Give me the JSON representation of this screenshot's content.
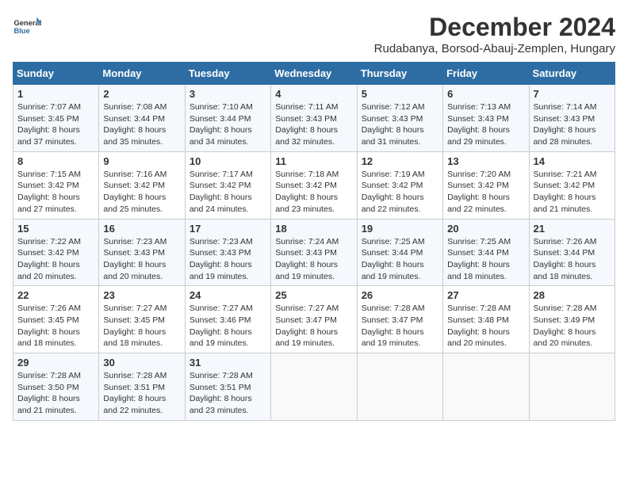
{
  "header": {
    "logo_line1": "General",
    "logo_line2": "Blue",
    "title": "December 2024",
    "subtitle": "Rudabanya, Borsod-Abauj-Zemplen, Hungary"
  },
  "days_of_week": [
    "Sunday",
    "Monday",
    "Tuesday",
    "Wednesday",
    "Thursday",
    "Friday",
    "Saturday"
  ],
  "weeks": [
    [
      {
        "day": 1,
        "sunrise": "7:07 AM",
        "sunset": "3:45 PM",
        "daylight": "8 hours and 37 minutes."
      },
      {
        "day": 2,
        "sunrise": "7:08 AM",
        "sunset": "3:44 PM",
        "daylight": "8 hours and 35 minutes."
      },
      {
        "day": 3,
        "sunrise": "7:10 AM",
        "sunset": "3:44 PM",
        "daylight": "8 hours and 34 minutes."
      },
      {
        "day": 4,
        "sunrise": "7:11 AM",
        "sunset": "3:43 PM",
        "daylight": "8 hours and 32 minutes."
      },
      {
        "day": 5,
        "sunrise": "7:12 AM",
        "sunset": "3:43 PM",
        "daylight": "8 hours and 31 minutes."
      },
      {
        "day": 6,
        "sunrise": "7:13 AM",
        "sunset": "3:43 PM",
        "daylight": "8 hours and 29 minutes."
      },
      {
        "day": 7,
        "sunrise": "7:14 AM",
        "sunset": "3:43 PM",
        "daylight": "8 hours and 28 minutes."
      }
    ],
    [
      {
        "day": 8,
        "sunrise": "7:15 AM",
        "sunset": "3:42 PM",
        "daylight": "8 hours and 27 minutes."
      },
      {
        "day": 9,
        "sunrise": "7:16 AM",
        "sunset": "3:42 PM",
        "daylight": "8 hours and 25 minutes."
      },
      {
        "day": 10,
        "sunrise": "7:17 AM",
        "sunset": "3:42 PM",
        "daylight": "8 hours and 24 minutes."
      },
      {
        "day": 11,
        "sunrise": "7:18 AM",
        "sunset": "3:42 PM",
        "daylight": "8 hours and 23 minutes."
      },
      {
        "day": 12,
        "sunrise": "7:19 AM",
        "sunset": "3:42 PM",
        "daylight": "8 hours and 22 minutes."
      },
      {
        "day": 13,
        "sunrise": "7:20 AM",
        "sunset": "3:42 PM",
        "daylight": "8 hours and 22 minutes."
      },
      {
        "day": 14,
        "sunrise": "7:21 AM",
        "sunset": "3:42 PM",
        "daylight": "8 hours and 21 minutes."
      }
    ],
    [
      {
        "day": 15,
        "sunrise": "7:22 AM",
        "sunset": "3:42 PM",
        "daylight": "8 hours and 20 minutes."
      },
      {
        "day": 16,
        "sunrise": "7:23 AM",
        "sunset": "3:43 PM",
        "daylight": "8 hours and 20 minutes."
      },
      {
        "day": 17,
        "sunrise": "7:23 AM",
        "sunset": "3:43 PM",
        "daylight": "8 hours and 19 minutes."
      },
      {
        "day": 18,
        "sunrise": "7:24 AM",
        "sunset": "3:43 PM",
        "daylight": "8 hours and 19 minutes."
      },
      {
        "day": 19,
        "sunrise": "7:25 AM",
        "sunset": "3:44 PM",
        "daylight": "8 hours and 19 minutes."
      },
      {
        "day": 20,
        "sunrise": "7:25 AM",
        "sunset": "3:44 PM",
        "daylight": "8 hours and 18 minutes."
      },
      {
        "day": 21,
        "sunrise": "7:26 AM",
        "sunset": "3:44 PM",
        "daylight": "8 hours and 18 minutes."
      }
    ],
    [
      {
        "day": 22,
        "sunrise": "7:26 AM",
        "sunset": "3:45 PM",
        "daylight": "8 hours and 18 minutes."
      },
      {
        "day": 23,
        "sunrise": "7:27 AM",
        "sunset": "3:45 PM",
        "daylight": "8 hours and 18 minutes."
      },
      {
        "day": 24,
        "sunrise": "7:27 AM",
        "sunset": "3:46 PM",
        "daylight": "8 hours and 19 minutes."
      },
      {
        "day": 25,
        "sunrise": "7:27 AM",
        "sunset": "3:47 PM",
        "daylight": "8 hours and 19 minutes."
      },
      {
        "day": 26,
        "sunrise": "7:28 AM",
        "sunset": "3:47 PM",
        "daylight": "8 hours and 19 minutes."
      },
      {
        "day": 27,
        "sunrise": "7:28 AM",
        "sunset": "3:48 PM",
        "daylight": "8 hours and 20 minutes."
      },
      {
        "day": 28,
        "sunrise": "7:28 AM",
        "sunset": "3:49 PM",
        "daylight": "8 hours and 20 minutes."
      }
    ],
    [
      {
        "day": 29,
        "sunrise": "7:28 AM",
        "sunset": "3:50 PM",
        "daylight": "8 hours and 21 minutes."
      },
      {
        "day": 30,
        "sunrise": "7:28 AM",
        "sunset": "3:51 PM",
        "daylight": "8 hours and 22 minutes."
      },
      {
        "day": 31,
        "sunrise": "7:28 AM",
        "sunset": "3:51 PM",
        "daylight": "8 hours and 23 minutes."
      },
      null,
      null,
      null,
      null
    ]
  ]
}
